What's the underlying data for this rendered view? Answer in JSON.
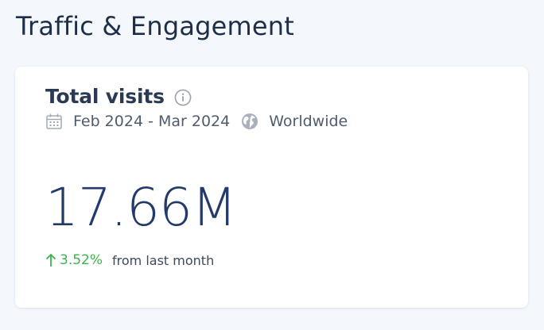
{
  "header": {
    "title": "Traffic & Engagement"
  },
  "card": {
    "title": "Total visits",
    "info_icon": "info-circle-icon",
    "date_icon": "calendar-icon",
    "date_range": "Feb 2024 - Mar 2024",
    "region_icon": "globe-icon",
    "region": "Worldwide",
    "total_visits": "17.66M",
    "change": {
      "direction_icon": "arrow-up-icon",
      "value": "3.52%",
      "caption": "from last month",
      "color": "#39b54a"
    }
  },
  "colors": {
    "background": "#f4f7fc",
    "card": "#ffffff",
    "heading": "#1d2f48",
    "metric": "#233a6b",
    "muted": "#4f5c6e"
  }
}
